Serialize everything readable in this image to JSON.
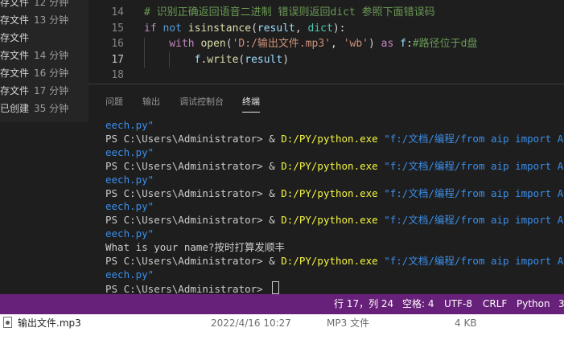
{
  "colors": {
    "accent_status": "#68217a",
    "comment": "#6a9955",
    "keyword": "#c586c0",
    "builtin": "#569cd6",
    "string": "#ce9178",
    "function": "#dcdcaa",
    "variable": "#9cdcfe",
    "path_yellow": "#f5f543",
    "string_blue": "#3b8eea"
  },
  "left_list": [
    {
      "name": "存文件",
      "time": "12 分钟"
    },
    {
      "name": "存文件",
      "time": "13 分钟"
    },
    {
      "name": "存文件",
      "time": ""
    },
    {
      "name": "存文件",
      "time": "14 分钟"
    },
    {
      "name": "存文件",
      "time": "16 分钟"
    },
    {
      "name": "存文件",
      "time": "17 分钟"
    },
    {
      "name": "已创建",
      "time": "35 分钟"
    }
  ],
  "editor": {
    "lines": [
      {
        "num": "14",
        "tokens": [
          {
            "t": "# 识别正确返回语音二进制 错误则返回dict 参照下面错误码",
            "c": "#6a9955"
          }
        ]
      },
      {
        "num": "15",
        "tokens": [
          {
            "t": "if ",
            "c": "#c586c0"
          },
          {
            "t": "not ",
            "c": "#569cd6"
          },
          {
            "t": "isinstance",
            "c": "#dcdcaa"
          },
          {
            "t": "(",
            "c": "#d4d4d4"
          },
          {
            "t": "result",
            "c": "#9cdcfe"
          },
          {
            "t": ", ",
            "c": "#d4d4d4"
          },
          {
            "t": "dict",
            "c": "#4ec9b0"
          },
          {
            "t": "):",
            "c": "#d4d4d4"
          }
        ]
      },
      {
        "num": "16",
        "tokens": [
          {
            "t": "    with ",
            "c": "#c586c0"
          },
          {
            "t": "open",
            "c": "#dcdcaa"
          },
          {
            "t": "(",
            "c": "#d4d4d4"
          },
          {
            "t": "'D:/输出文件.mp3'",
            "c": "#ce9178"
          },
          {
            "t": ", ",
            "c": "#d4d4d4"
          },
          {
            "t": "'wb'",
            "c": "#ce9178"
          },
          {
            "t": ") ",
            "c": "#d4d4d4"
          },
          {
            "t": "as ",
            "c": "#c586c0"
          },
          {
            "t": "f",
            "c": "#9cdcfe"
          },
          {
            "t": ":",
            "c": "#d4d4d4"
          },
          {
            "t": "#路径位于d盘",
            "c": "#6a9955"
          }
        ]
      },
      {
        "num": "17",
        "tokens": [
          {
            "t": "        ",
            "c": "#d4d4d4"
          },
          {
            "t": "f",
            "c": "#9cdcfe"
          },
          {
            "t": ".",
            "c": "#d4d4d4"
          },
          {
            "t": "write",
            "c": "#dcdcaa"
          },
          {
            "t": "(",
            "c": "#d4d4d4"
          },
          {
            "t": "result",
            "c": "#9cdcfe"
          },
          {
            "t": ")",
            "c": "#d4d4d4"
          }
        ]
      },
      {
        "num": "18",
        "tokens": []
      }
    ]
  },
  "panel_tabs": [
    "问题",
    "输出",
    "调试控制台",
    "终端"
  ],
  "terminal": {
    "prompt": "PS C:\\Users\\Administrator> ",
    "amp": "& ",
    "exe": "D:/PY/python.exe",
    "arg": " \"f:/文档/编程/from aip import AipSp",
    "wrap_tail": "eech.py\"",
    "user_output": "What is your name?按时打算发顺丰"
  },
  "statusbar": {
    "position": "行 17，列 24",
    "spaces": "空格: 4",
    "encoding": "UTF-8",
    "eol": "CRLF",
    "language": "Python",
    "extra": "3"
  },
  "explorer_row": {
    "icon": "audio-file-icon",
    "name": "输出文件.mp3",
    "date": "2022/4/16 10:27",
    "type": "MP3 文件",
    "size": "4 KB"
  }
}
